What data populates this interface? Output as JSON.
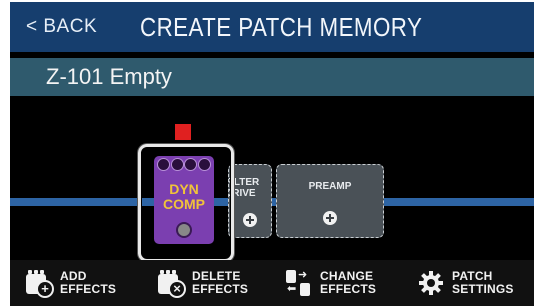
{
  "header": {
    "back_label": "< BACK",
    "title": "CREATE PATCH MEMORY"
  },
  "patch": {
    "name": "Z-101 Empty"
  },
  "chain": {
    "selected_effect": {
      "name": "DYN\nCOMP",
      "color": "#7b3fb0",
      "label_color": "#f0c33a",
      "indicator_color": "#e02020"
    },
    "slots": [
      {
        "label": "FILTER\nDRIVE",
        "icon": "plus-circle-icon"
      },
      {
        "label": "PREAMP",
        "icon": "plus-circle-icon"
      }
    ]
  },
  "toolbar": {
    "add_label": "ADD\nEFFECTS",
    "delete_label": "DELETE\nEFFECTS",
    "change_label": "CHANGE\nEFFECTS",
    "settings_label": "PATCH\nSETTINGS"
  },
  "colors": {
    "topbar": "#163e6e",
    "namebar": "#2f5a6d",
    "signal_line": "#2d64a4",
    "slot_bg": "#4a5157"
  }
}
